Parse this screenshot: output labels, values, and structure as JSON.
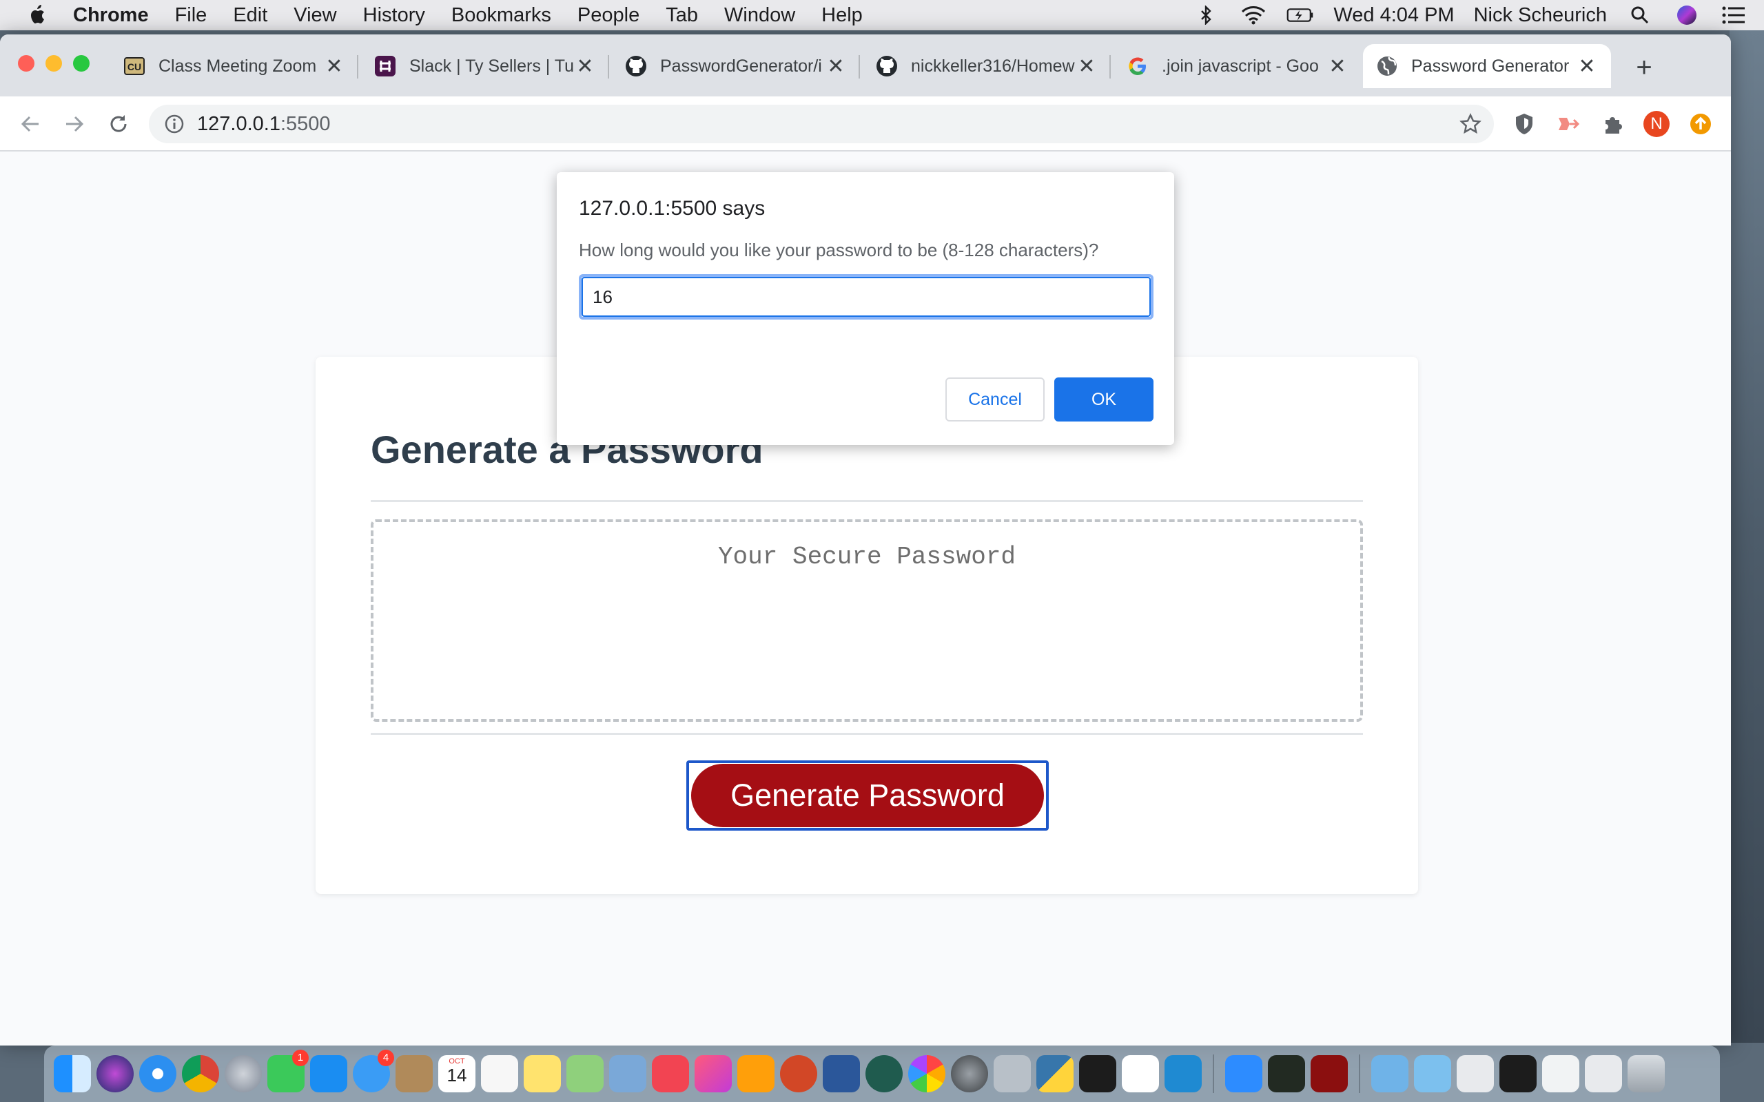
{
  "menubar": {
    "app_name": "Chrome",
    "menus": [
      "File",
      "Edit",
      "View",
      "History",
      "Bookmarks",
      "People",
      "Tab",
      "Window",
      "Help"
    ],
    "clock": "Wed 4:04 PM",
    "user": "Nick Scheurich"
  },
  "tabs": [
    {
      "title": "Class Meeting Zoom",
      "favicon": "cu-logo-icon"
    },
    {
      "title": "Slack | Ty Sellers | Tu",
      "favicon": "slack-icon"
    },
    {
      "title": "PasswordGenerator/i",
      "favicon": "github-icon"
    },
    {
      "title": "nickkeller316/Homew",
      "favicon": "github-icon"
    },
    {
      "title": ".join javascript - Goo",
      "favicon": "google-icon"
    },
    {
      "title": "Password Generator",
      "favicon": "globe-icon",
      "active": true
    }
  ],
  "address": {
    "host": "127.0.0.1",
    "port": ":5500"
  },
  "profile_initial": "N",
  "page": {
    "heading": "Generate a Password",
    "password_placeholder": "Your Secure Password",
    "generate_label": "Generate Password"
  },
  "dialog": {
    "origin": "127.0.0.1:5500 says",
    "message": "How long would you like your password to be (8-128 characters)?",
    "input_value": "16",
    "cancel_label": "Cancel",
    "ok_label": "OK"
  },
  "dock": {
    "facetime_badge": "1",
    "messages_badge": "4",
    "calendar_month": "OCT",
    "calendar_day": "14"
  },
  "colors": {
    "generate_button": "#a50e14",
    "dialog_ok": "#1a73e8",
    "heading": "#2f3e4c"
  }
}
